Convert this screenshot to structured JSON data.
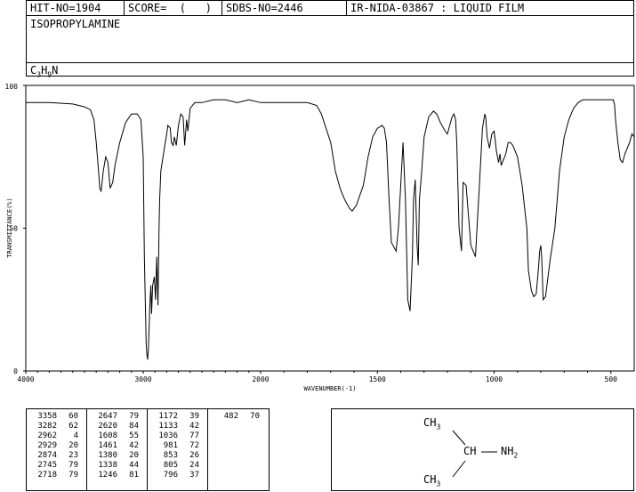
{
  "header": {
    "hit_no": "HIT-NO=1904",
    "score": "SCORE=  (   )",
    "sdbs_no": "SDBS-NO=2446",
    "ir_info": "IR-NIDA-03867 : LIQUID FILM",
    "compound_name": "ISOPROPYLAMINE",
    "formula": {
      "c": "C",
      "c_n": "3",
      "h": "H",
      "h_n": "9",
      "n": "N"
    }
  },
  "chart_data": {
    "type": "line",
    "title": "",
    "xlabel": "WAVENUMBER(-1)",
    "ylabel": "TRANSMITTANCE(%)",
    "xlim": [
      4000,
      400
    ],
    "ylim": [
      0,
      100
    ],
    "x_ticks": [
      4000,
      3000,
      2000,
      1500,
      1000,
      500
    ],
    "y_ticks": [
      100,
      50,
      0
    ],
    "line_color": "#000000",
    "x": [
      4000,
      3800,
      3600,
      3500,
      3450,
      3420,
      3400,
      3380,
      3370,
      3358,
      3340,
      3320,
      3300,
      3282,
      3260,
      3240,
      3200,
      3150,
      3100,
      3050,
      3020,
      3000,
      2990,
      2975,
      2970,
      2962,
      2955,
      2945,
      2935,
      2929,
      2920,
      2905,
      2895,
      2885,
      2874,
      2865,
      2860,
      2850,
      2820,
      2800,
      2790,
      2770,
      2760,
      2745,
      2735,
      2718,
      2700,
      2680,
      2660,
      2647,
      2630,
      2620,
      2600,
      2560,
      2500,
      2400,
      2300,
      2200,
      2100,
      2000,
      1900,
      1800,
      1760,
      1740,
      1720,
      1700,
      1680,
      1660,
      1640,
      1620,
      1608,
      1590,
      1560,
      1540,
      1520,
      1500,
      1480,
      1470,
      1461,
      1450,
      1440,
      1420,
      1410,
      1400,
      1390,
      1380,
      1370,
      1360,
      1350,
      1345,
      1338,
      1330,
      1325,
      1320,
      1310,
      1300,
      1280,
      1260,
      1246,
      1230,
      1210,
      1200,
      1190,
      1180,
      1172,
      1165,
      1160,
      1150,
      1140,
      1133,
      1120,
      1100,
      1080,
      1060,
      1050,
      1040,
      1036,
      1030,
      1020,
      1010,
      1000,
      990,
      981,
      975,
      970,
      960,
      950,
      940,
      930,
      920,
      900,
      880,
      860,
      853,
      840,
      830,
      820,
      810,
      805,
      800,
      796,
      790,
      780,
      760,
      740,
      720,
      700,
      680,
      660,
      640,
      620,
      600,
      580,
      560,
      540,
      520,
      500,
      490,
      484,
      480,
      470,
      460,
      450,
      440,
      420,
      410,
      400
    ],
    "y": [
      94,
      94,
      93.5,
      92.5,
      91.5,
      88,
      80,
      70,
      64,
      63,
      70,
      75,
      73,
      64,
      66,
      72,
      80,
      87,
      90,
      90,
      88,
      75,
      40,
      10,
      6,
      4,
      8,
      22,
      30,
      20,
      30,
      33,
      25,
      40,
      23,
      50,
      60,
      70,
      78,
      83,
      86,
      85,
      80,
      79,
      82,
      79,
      86,
      90,
      89,
      79,
      88,
      84,
      92,
      94,
      94,
      95,
      95,
      94,
      95,
      94,
      94,
      94,
      93,
      90,
      85,
      80,
      70,
      64,
      60,
      57,
      56,
      58,
      65,
      75,
      82,
      85,
      86,
      85,
      80,
      60,
      45,
      42,
      50,
      65,
      80,
      60,
      25,
      21,
      40,
      60,
      67,
      44,
      37,
      60,
      70,
      82,
      89,
      91,
      90,
      87,
      84,
      83,
      86,
      89,
      90,
      88,
      80,
      50,
      42,
      66,
      65,
      44,
      40,
      70,
      85,
      90,
      89,
      82,
      78,
      83,
      84,
      77,
      73,
      76,
      72,
      74,
      76,
      80,
      80,
      79,
      75,
      65,
      50,
      35,
      28,
      26,
      27,
      36,
      42,
      44,
      40,
      25,
      26,
      39,
      50,
      70,
      82,
      88,
      92,
      94,
      95,
      95,
      95,
      95,
      95,
      95,
      95,
      95,
      93,
      88,
      80,
      74,
      73,
      76,
      80,
      83,
      82,
      80,
      76,
      75,
      78
    ]
  },
  "peak_table": {
    "columns": [
      [
        [
          "3358",
          "60"
        ],
        [
          "3282",
          "62"
        ],
        [
          "2962",
          "4"
        ],
        [
          "2929",
          "20"
        ],
        [
          "2874",
          "23"
        ],
        [
          "2745",
          "79"
        ],
        [
          "2718",
          "79"
        ]
      ],
      [
        [
          "2647",
          "79"
        ],
        [
          "2620",
          "84"
        ],
        [
          "1608",
          "55"
        ],
        [
          "1461",
          "42"
        ],
        [
          "1380",
          "20"
        ],
        [
          "1338",
          "44"
        ],
        [
          "1246",
          "81"
        ]
      ],
      [
        [
          "1172",
          "39"
        ],
        [
          "1133",
          "42"
        ],
        [
          "1036",
          "77"
        ],
        [
          "981",
          "72"
        ],
        [
          "853",
          "26"
        ],
        [
          "805",
          "24"
        ],
        [
          "796",
          "37"
        ]
      ],
      [
        [
          "482",
          "70"
        ]
      ]
    ]
  },
  "structure": {
    "ch3_top": {
      "main": "CH",
      "sub": "3"
    },
    "ch": "CH",
    "nh2": {
      "main": "NH",
      "sub": "2"
    },
    "ch3_bottom": {
      "main": "CH",
      "sub": "3"
    }
  }
}
